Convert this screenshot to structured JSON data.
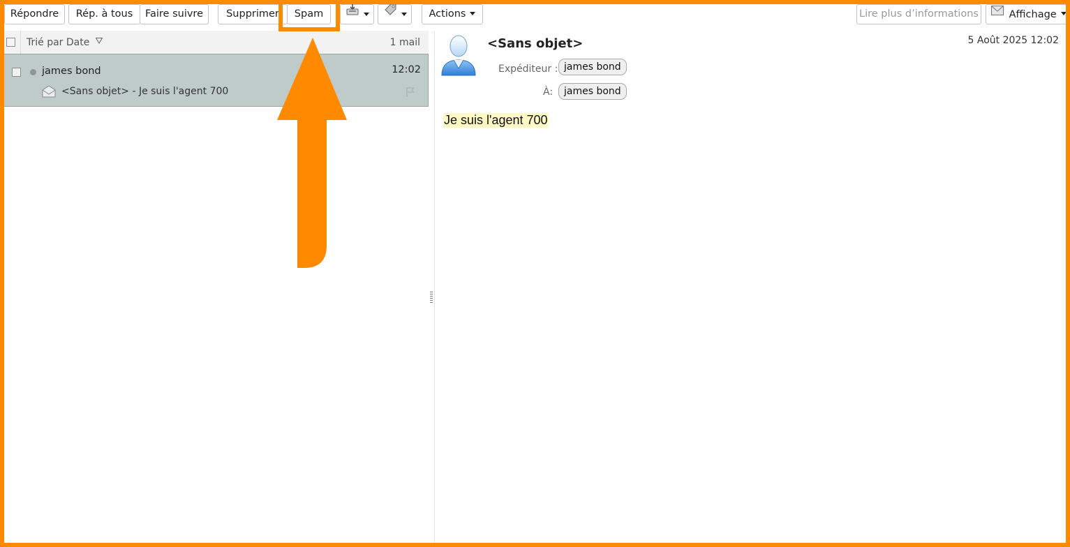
{
  "toolbar": {
    "reply": "Répondre",
    "reply_all": "Rép. à tous",
    "forward": "Faire suivre",
    "delete": "Supprimer",
    "spam": "Spam",
    "move_icon": "tray-move-icon",
    "tag_icon": "tag-icon",
    "actions": "Actions",
    "read_more": "Lire plus d’informations",
    "view": "Affichage",
    "view_icon": "envelope-icon"
  },
  "list": {
    "sort_label": "Trié par Date",
    "count": "1 mail",
    "messages": [
      {
        "sender": "james bond",
        "time": "12:02",
        "subject": "<Sans objet> - Je suis l'agent 700"
      }
    ]
  },
  "message": {
    "subject": "<Sans objet>",
    "date": "5 Août 2025 12:02",
    "from_label": "Expéditeur :",
    "from": "james bond",
    "to_label": "À:",
    "to": "james bond",
    "body": "Je suis l'agent 700"
  },
  "colors": {
    "annotation": "#ff8a00",
    "selected_row": "#bfcbc9",
    "body_highlight": "#fff7c4"
  }
}
